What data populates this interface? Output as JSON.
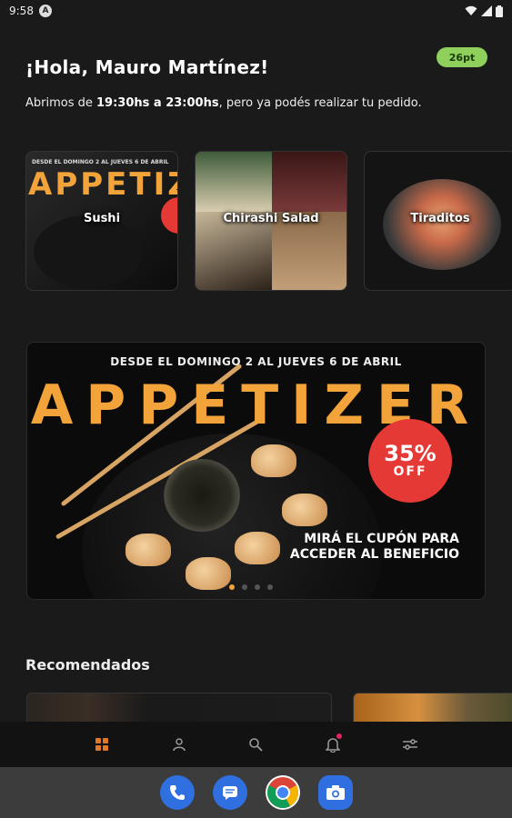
{
  "status_bar": {
    "time": "9:58",
    "badge": "A"
  },
  "header": {
    "greeting": "¡Hola, Mauro Martínez!",
    "points_badge": "26pt",
    "hours_prefix": "Abrimos de ",
    "hours_range": "19:30hs a 23:00hs",
    "hours_suffix": ", pero ya podés realizar tu pedido."
  },
  "categories": [
    {
      "label": "Sushi",
      "promo_line": "DESDE EL DOMINGO 2 AL JUEVES 6 DE ABRIL",
      "promo_word": "APPETIZER"
    },
    {
      "label": "Chirashi Salad"
    },
    {
      "label": "Tiraditos"
    }
  ],
  "banner": {
    "top_text": "DESDE EL DOMINGO 2 AL JUEVES 6 DE ABRIL",
    "big_text": "APPETIZER",
    "discount_pct": "35%",
    "discount_word": "OFF",
    "cta": "MIRÁ EL CUPÓN PARA ACCEDER AL BENEFICIO",
    "active_slide": 0,
    "total_slides": 4
  },
  "recommended": {
    "title": "Recomendados"
  },
  "bottom_nav": [
    {
      "icon": "grid-icon",
      "active": true
    },
    {
      "icon": "user-icon",
      "active": false
    },
    {
      "icon": "search-icon",
      "active": false
    },
    {
      "icon": "bell-icon",
      "active": false,
      "badge": true
    },
    {
      "icon": "filters-icon",
      "active": false
    }
  ],
  "dock_apps": [
    "phone-icon",
    "messages-icon",
    "chrome-icon",
    "camera-icon"
  ],
  "colors": {
    "accent": "#f2a33a",
    "nav_active": "#e0782a",
    "points_bg": "#8fcf5c",
    "discount_red": "#e53935"
  }
}
